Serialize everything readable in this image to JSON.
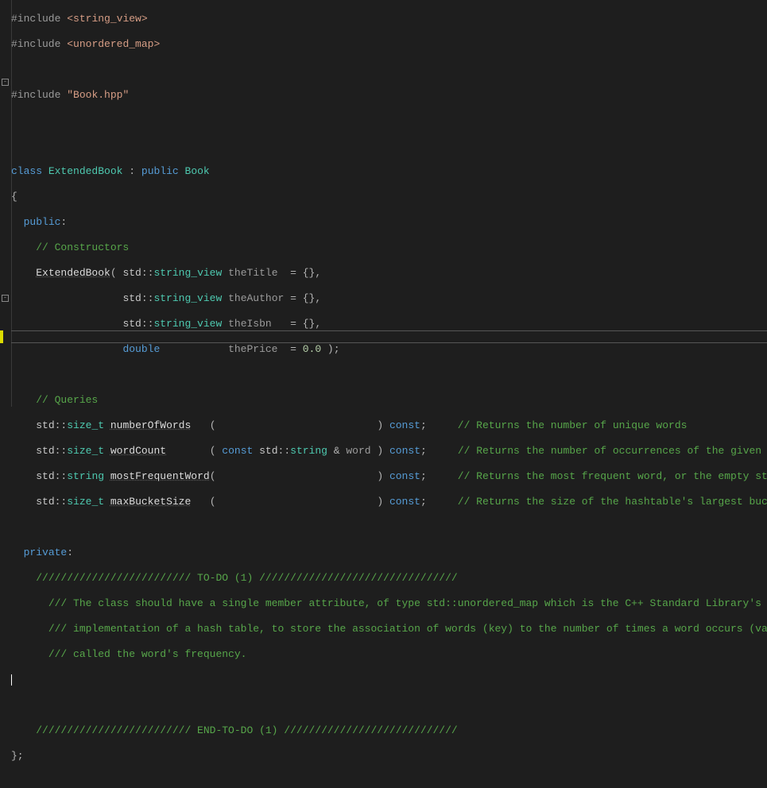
{
  "lines": {
    "l1": "#include <string_view>",
    "l2": "#include <unordered_map>",
    "l3": "",
    "l4": "#include \"Book.hpp\"",
    "l5": "",
    "l6": "",
    "l7": "class ExtendedBook : public Book",
    "l8": "{",
    "l9": "  public:",
    "l10": "    // Constructors",
    "l11": "    ExtendedBook( std::string_view theTitle  = {},",
    "l12": "                  std::string_view theAuthor = {},",
    "l13": "                  std::string_view theIsbn   = {},",
    "l14": "                  double           thePrice  = 0.0 );",
    "l15": "",
    "l16": "    // Queries",
    "l17": "    std::size_t numberOfWords   (                          ) const;     // Returns the number of unique words",
    "l18": "    std::size_t wordCount       ( const std::string & word ) const;     // Returns the number of occurrences of the given word",
    "l19": "    std::string mostFrequentWord(                          ) const;     // Returns the most frequent word, or the empty string if the Bo",
    "l20": "    std::size_t maxBucketSize   (                          ) const;     // Returns the size of the hashtable's largest bucket. See the u",
    "l21": "",
    "l22": "  private:",
    "l23": "    ///////////////////////// TO-DO (1) ////////////////////////////////",
    "l24": "      /// The class should have a single member attribute, of type std::unordered_map which is the C++ Standard Library's",
    "l25": "      /// implementation of a hash table, to store the association of words (key) to the number of times a word occurs (value), also",
    "l26": "      /// called the word's frequency.",
    "l27": "",
    "l28": "",
    "l29": "    ///////////////////////// END-TO-DO (1) ////////////////////////////",
    "l30": "};"
  },
  "tokens": {
    "include": "#include",
    "svinc": "<string_view>",
    "uminc": "<unordered_map>",
    "bookinc": "\"Book.hpp\"",
    "class": "class",
    "ExtendedBook": "ExtendedBook",
    "public": "public",
    "Book": "Book",
    "publicLbl": "public",
    "privateLbl": "private",
    "ctorsCmt": "// Constructors",
    "queriesCmt": "// Queries",
    "std": "std",
    "string_view": "string_view",
    "string": "string",
    "size_t": "size_t",
    "doubleKw": "double",
    "constKw": "const",
    "theTitle": "theTitle",
    "theAuthor": "theAuthor",
    "theIsbn": "theIsbn",
    "thePrice": "thePrice",
    "eqBraces": "= {}",
    "eqZero": "= ",
    "zero": "0.0",
    "numberOfWords": "numberOfWords",
    "wordCount": "wordCount",
    "mostFrequentWord": "mostFrequentWord",
    "maxBucketSize": "maxBucketSize",
    "word": "word",
    "cmt17": "// Returns the number of unique words",
    "cmt18": "// Returns the number of occurrences of the given word",
    "cmt19": "// Returns the most frequent word, or the empty string if the Bo",
    "cmt20": "// Returns the size of the hashtable's largest bucket. See the u",
    "todo1": "///////////////////////// TO-DO (1) ////////////////////////////////",
    "todo2": "/// The class should have a single member attribute, of type std::unordered_map which is the C++ Standard Library's",
    "todo3": "/// implementation of a hash table, to store the association of words (key) to the number of times a word occurs (value), also",
    "todo4": "/// called the word's frequency.",
    "endtodo": "///////////////////////// END-TO-DO (1) ////////////////////////////"
  },
  "colors": {
    "keyword": "#569cd6",
    "type": "#4ec9b0",
    "comment": "#57a64a",
    "string": "#d69d85",
    "number": "#b5cea8",
    "preproc": "#9b9b9b",
    "default": "#dcdcdc",
    "background": "#1e1e1e"
  }
}
